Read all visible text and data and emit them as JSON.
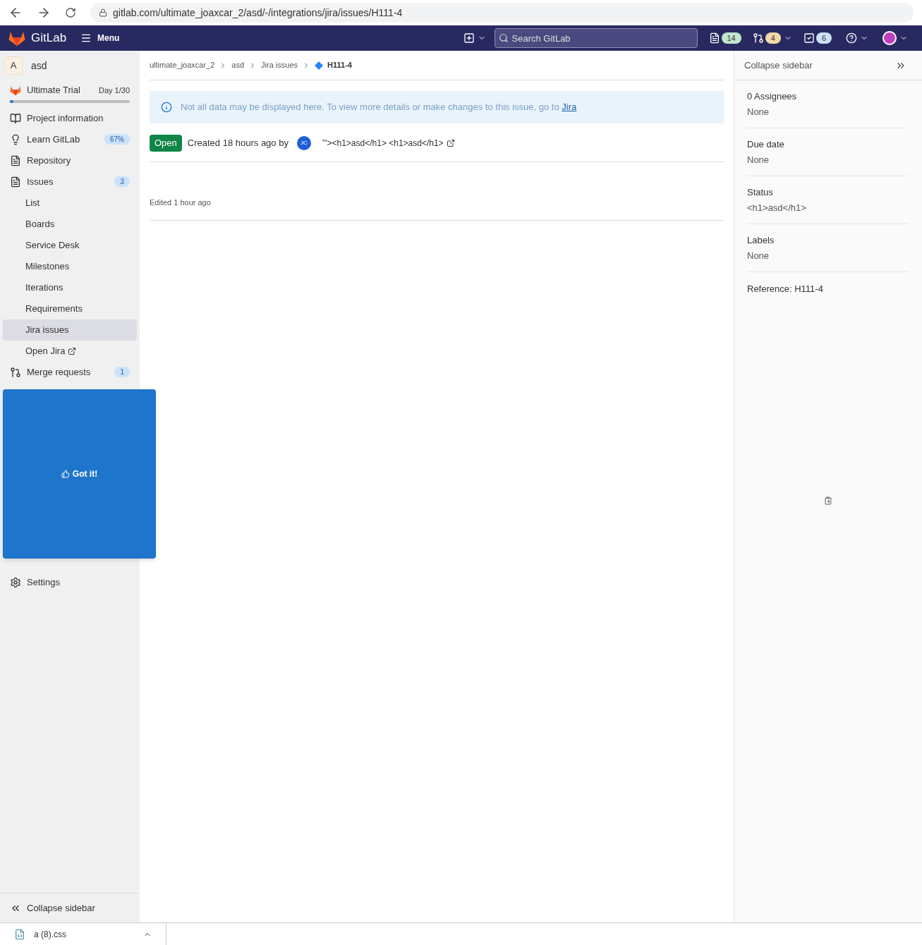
{
  "browser": {
    "url": "gitlab.com/ultimate_joaxcar_2/asd/-/integrations/jira/issues/H111-4"
  },
  "navbar": {
    "brand": "GitLab",
    "menu": "Menu",
    "search": {
      "placeholder": "Search GitLab"
    },
    "counters": [
      {
        "kind": "issues",
        "count": "14",
        "color": "#c3e6cd"
      },
      {
        "kind": "merge",
        "count": "4",
        "color": "#f5d9a8"
      },
      {
        "kind": "todos",
        "count": "6",
        "color": "#cbe2f9"
      }
    ]
  },
  "sidebar": {
    "project": {
      "avatar": "A",
      "name": "asd"
    },
    "trial": {
      "label": "Ultimate Trial",
      "day": "Day 1/30",
      "level": 0.03
    },
    "items": [
      {
        "kind": "info",
        "label": "Project information",
        "selected": false
      },
      {
        "kind": "learn",
        "label": "Learn GitLab",
        "badge": "67%",
        "selected": false
      },
      {
        "kind": "repository",
        "label": "Repository",
        "selected": false
      },
      {
        "kind": "issues",
        "label": "Issues",
        "badge": "3",
        "selected": false,
        "children": [
          {
            "label": "List",
            "selected": false
          },
          {
            "label": "Boards",
            "selected": false
          },
          {
            "label": "Service Desk",
            "selected": false
          },
          {
            "label": "Milestones",
            "selected": false
          },
          {
            "label": "Iterations",
            "selected": false
          },
          {
            "label": "Requirements",
            "selected": false
          },
          {
            "label": "Jira issues",
            "selected": true
          },
          {
            "label": "Open Jira",
            "selected": false,
            "external": true
          }
        ]
      },
      {
        "kind": "merge",
        "label": "Merge requests",
        "badge": "1",
        "selected": false
      },
      {
        "kind": "hidden"
      },
      {
        "kind": "settings",
        "label": "Settings",
        "selected": false
      }
    ],
    "collapse": "Collapse sidebar"
  },
  "popover": {
    "button": "Got it!"
  },
  "breadcrumbs": [
    {
      "label": "ultimate_joaxcar_2",
      "current": false
    },
    {
      "label": "asd",
      "current": false
    },
    {
      "label": "Jira issues",
      "current": false
    },
    {
      "label": "H111-4",
      "current": true
    }
  ],
  "alert": {
    "text": "Not all data may be displayed here. To view more details or make changes to this issue, go to",
    "link": "Jira"
  },
  "issue": {
    "status": "Open",
    "created": "Created 18 hours ago by",
    "author": "JC",
    "title": "\"'><h1>asd</h1> <h1>asd</h1>",
    "edited": "Edited 1 hour ago"
  },
  "right_sidebar": {
    "collapse": "Collapse sidebar",
    "fields": [
      {
        "label": "0 Assignees",
        "value": "None"
      },
      {
        "label": "Due date",
        "value": "None"
      },
      {
        "label": "Status",
        "value": "<h1>asd</h1>"
      },
      {
        "label": "Labels",
        "value": "None"
      }
    ],
    "reference": "Reference: H111-4"
  },
  "downloads": [
    {
      "name": "a (8).css"
    }
  ]
}
